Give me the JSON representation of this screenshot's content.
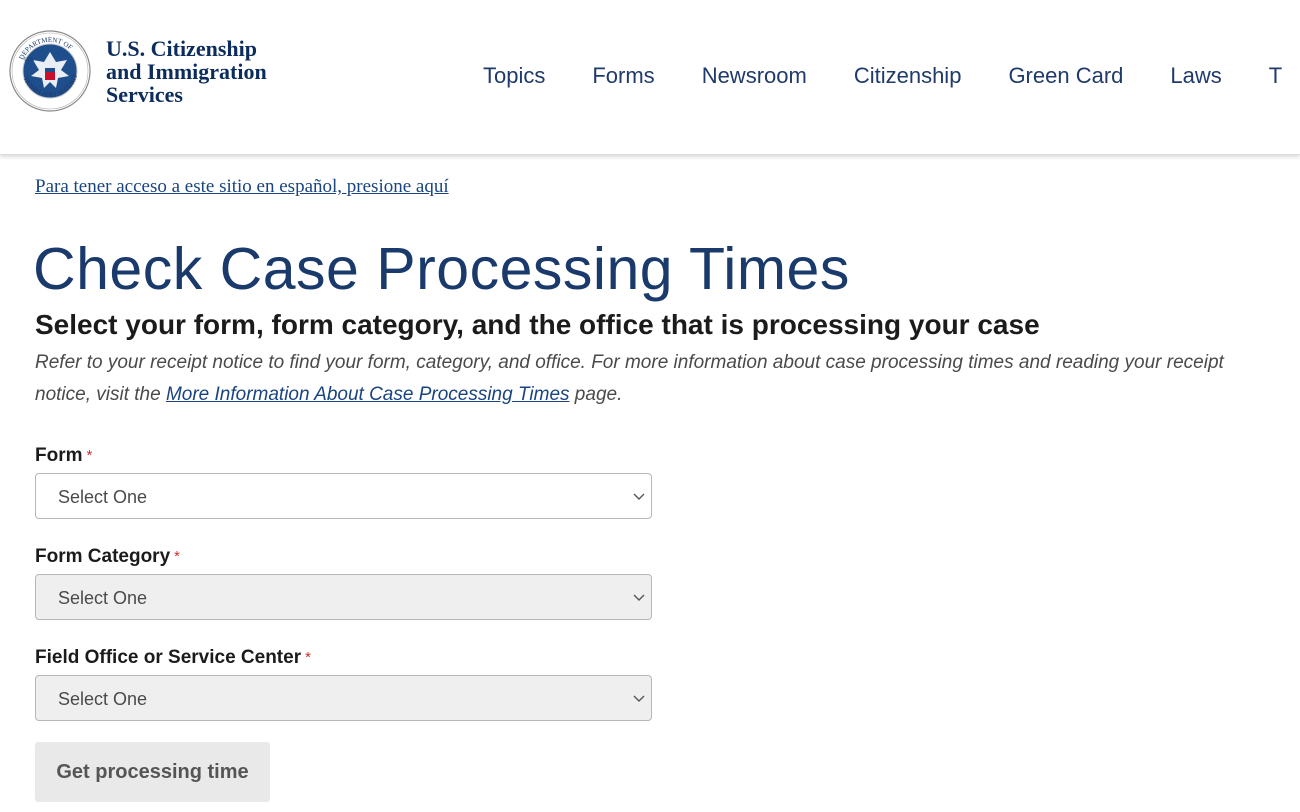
{
  "header": {
    "agency_line1": "U.S. Citizenship",
    "agency_line2": "and Immigration",
    "agency_line3": "Services",
    "seal_top_text": "DEPARTMENT OF",
    "seal_bottom_text": "HOMELAND SECURITY",
    "seal_left_text": "U.S.",
    "nav": [
      "Topics",
      "Forms",
      "Newsroom",
      "Citizenship",
      "Green Card",
      "Laws",
      "T"
    ]
  },
  "spanish_link": "Para tener acceso a este sitio en español, presione aquí",
  "page_title": "Check Case Processing Times",
  "subtitle": "Select your form, form category, and the office that is processing your case",
  "help": {
    "before": "Refer to your receipt notice to find your form, category, and office. For more information about case processing times and reading your receipt notice, visit the ",
    "link": "More Information About Case Processing Times",
    "after": " page."
  },
  "form": {
    "required_mark": "*",
    "fields": [
      {
        "label": "Form",
        "value": "Select One",
        "disabled": false
      },
      {
        "label": "Form Category",
        "value": "Select One",
        "disabled": true
      },
      {
        "label": "Field Office or Service Center",
        "value": "Select One",
        "disabled": true
      }
    ],
    "submit_label": "Get processing time"
  },
  "colors": {
    "brand_navy": "#1a3a6c",
    "link": "#1a4480",
    "required": "#c9302c"
  }
}
